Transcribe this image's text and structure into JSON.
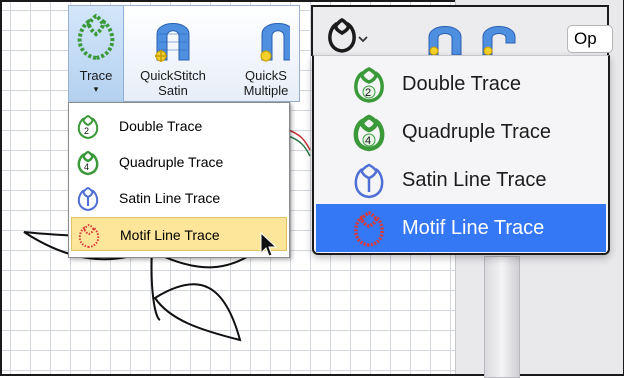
{
  "ribbon": {
    "trace_label": "Trace",
    "quickstitch_satin_line1": "QuickStitch",
    "quickstitch_satin_line2": "Satin",
    "quickstitch_multiple_line1": "QuickS",
    "quickstitch_multiple_line2": "Multiple"
  },
  "windows_menu": {
    "items": [
      {
        "label": "Double Trace",
        "icon": "double-trace-icon",
        "badge": "2"
      },
      {
        "label": "Quadruple Trace",
        "icon": "quadruple-trace-icon",
        "badge": "4"
      },
      {
        "label": "Satin Line Trace",
        "icon": "satin-line-trace-icon"
      },
      {
        "label": "Motif Line Trace",
        "icon": "motif-line-trace-icon",
        "selected": true
      }
    ]
  },
  "mac_menu": {
    "options_label": "Op",
    "items": [
      {
        "label": "Double Trace",
        "icon": "double-trace-icon",
        "badge": "2"
      },
      {
        "label": "Quadruple Trace",
        "icon": "quadruple-trace-icon",
        "badge": "4"
      },
      {
        "label": "Satin Line Trace",
        "icon": "satin-line-trace-icon"
      },
      {
        "label": "Motif Line Trace",
        "icon": "motif-line-trace-icon",
        "selected": true
      }
    ]
  },
  "colors": {
    "green_stitch": "#3a9a3a",
    "blue_satin": "#4f6fd6",
    "red_motif": "#d83a3a",
    "mac_selection": "#3478f6",
    "win_selection": "#fde59a"
  }
}
